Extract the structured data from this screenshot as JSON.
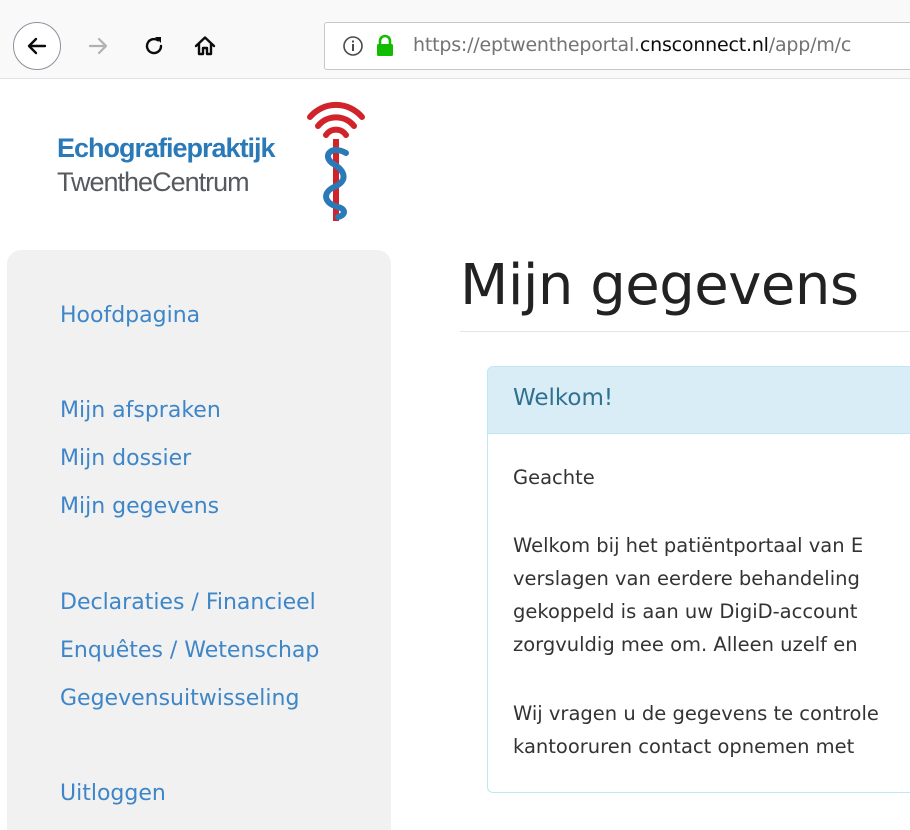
{
  "browser": {
    "url_prefix": "https://eptwentheportal.",
    "url_domain": "cnsconnect.nl",
    "url_suffix": "/app/m/c"
  },
  "logo": {
    "line1": "Echografiepraktijk",
    "line2": "TwentheCentrum"
  },
  "sidebar": {
    "items": [
      {
        "label": "Hoofdpagina"
      },
      {
        "label": "Mijn afspraken"
      },
      {
        "label": "Mijn dossier"
      },
      {
        "label": "Mijn gegevens"
      },
      {
        "label": "Declaraties / Financieel"
      },
      {
        "label": "Enquêtes / Wetenschap"
      },
      {
        "label": "Gegevensuitwisseling"
      },
      {
        "label": "Uitloggen"
      }
    ]
  },
  "main": {
    "title": "Mijn gegevens",
    "panel": {
      "heading": "Welkom!",
      "greeting": "Geachte",
      "intro_lines": [
        "Welkom bij het patiëntportaal van E",
        "verslagen van eerdere behandeling",
        "gekoppeld is aan uw DigiD-account",
        "zorgvuldig mee om. Alleen uzelf en"
      ],
      "check_lines": [
        "Wij vragen u de gegevens te controle",
        "kantooruren contact opnemen met"
      ]
    }
  },
  "colors": {
    "link": "#3e86c7",
    "panel_header_bg": "#d9edf7",
    "panel_header_text": "#31708f",
    "logo_blue": "#2a7ab8",
    "logo_red": "#d0232a"
  }
}
